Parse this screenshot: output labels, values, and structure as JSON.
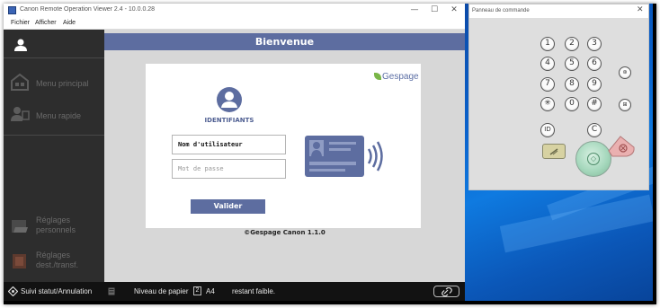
{
  "viewer": {
    "title": "Canon Remote Operation Viewer 2.4 - 10.0.0.28",
    "menu": [
      "Fichier",
      "Afficher",
      "Aide"
    ],
    "window_controls": [
      "—",
      "☐",
      "✕"
    ]
  },
  "sidebar": {
    "items": [
      {
        "label": "Menu principal",
        "icon": "home-icon"
      },
      {
        "label": "Menu rapide",
        "icon": "quick-menu-icon"
      },
      {
        "label": "Réglages personnels",
        "icon": "personal-settings-icon"
      },
      {
        "label": "Réglages dest./transf.",
        "icon": "destination-settings-icon"
      }
    ]
  },
  "main": {
    "welcome_title": "Bienvenue",
    "logo_text": "Gespage",
    "ident_label": "IDENTIFIANTS",
    "username_value": "Nom d'utilisateur",
    "password_placeholder": "Mot de passe",
    "validate_label": "Valider",
    "copyright": "©Gespage Canon 1.1.0"
  },
  "statusbar": {
    "status_label": "Suivi statut/Annulation",
    "paper_label": "Niveau de papier",
    "paper_tray": "2",
    "paper_size": "A4",
    "paper_state": "restant faible."
  },
  "panel": {
    "title": "Panneau de commande",
    "close": "✕",
    "keys": [
      "1",
      "2",
      "3",
      "4",
      "5",
      "6",
      "7",
      "8",
      "9",
      "✳",
      "0",
      "#",
      "ID",
      "C"
    ],
    "side_keys": [
      "⊛",
      "⊞"
    ]
  },
  "colors": {
    "accent": "#5d6da0",
    "sidebar_bg": "#2d2d2d",
    "content_bg": "#d7d7d7",
    "start_green": "#a6d8bd",
    "stop_red": "#e8a8a8"
  }
}
